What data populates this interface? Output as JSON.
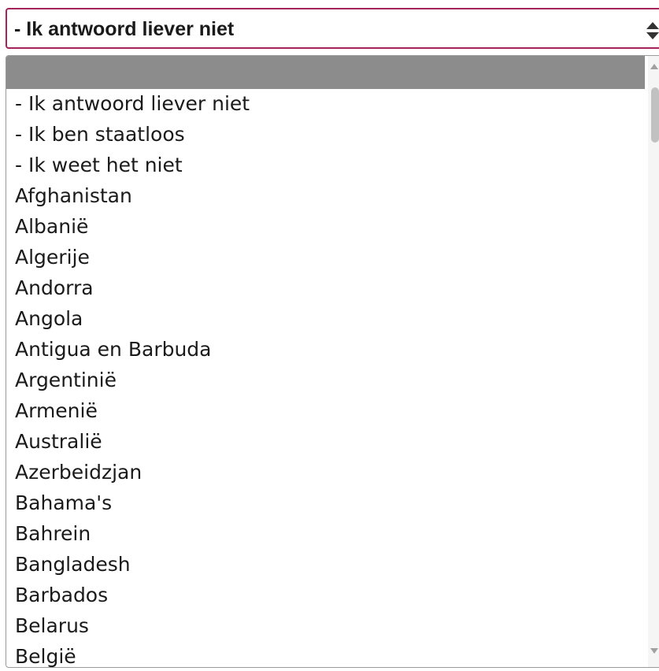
{
  "select": {
    "value": "- Ik antwoord liever niet",
    "arrows_icon": "sort-arrows-icon",
    "border_color": "#a3245a"
  },
  "dropdown": {
    "highlight_color": "#8c8c8c",
    "options": [
      "- Ik antwoord liever niet",
      "- Ik ben staatloos",
      "- Ik weet het niet",
      "Afghanistan",
      "Albanië",
      "Algerije",
      "Andorra",
      "Angola",
      "Antigua en Barbuda",
      "Argentinië",
      "Armenië",
      "Australië",
      "Azerbeidzjan",
      "Bahama's",
      "Bahrein",
      "Bangladesh",
      "Barbados",
      "Belarus",
      "België"
    ]
  }
}
